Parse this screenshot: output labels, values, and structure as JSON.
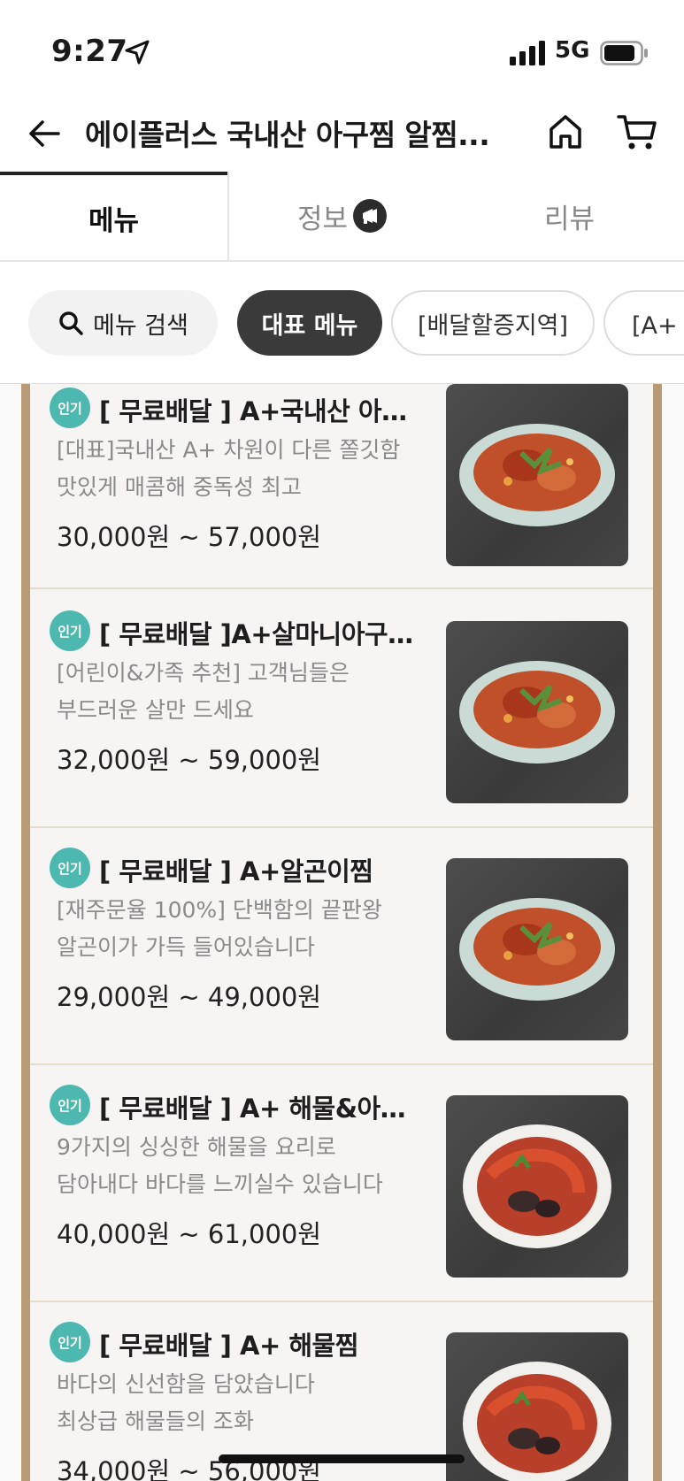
{
  "status_bar": {
    "time": "9:27",
    "network": "5G"
  },
  "header": {
    "title": "에이플러스 국내산 아구찜 알찜..."
  },
  "tabs": [
    {
      "label": "메뉴"
    },
    {
      "label": "정보"
    },
    {
      "label": "리뷰"
    }
  ],
  "chips": {
    "search": "메뉴 검색",
    "representative": "대표 메뉴",
    "surcharge": "[배달할증지역]",
    "more": "[A+ 추"
  },
  "menu_items": [
    {
      "badge": "인기",
      "name": "[ 무료배달 ] A+국내산 아…",
      "desc1": "[대표]국내산 A+ 차원이 다른 쫄깃함",
      "desc2": "맛있게 매콤해 중독성 최고",
      "price": "30,000원 ~ 57,000원"
    },
    {
      "badge": "인기",
      "name": "[ 무료배달 ]A+살마니아구…",
      "desc1": "[어린이&가족 추천] 고객님들은",
      "desc2": "부드러운 살만 드세요",
      "price": "32,000원 ~ 59,000원"
    },
    {
      "badge": "인기",
      "name": "[ 무료배달 ] A+알곤이찜",
      "desc1": "[재주문율 100%] 단백함의 끝판왕",
      "desc2": "알곤이가 가득 들어있습니다",
      "price": "29,000원 ~ 49,000원"
    },
    {
      "badge": "인기",
      "name": "[ 무료배달 ] A+ 해물&아…",
      "desc1": "9가지의 싱싱한 해물을 요리로",
      "desc2": "담아내다 바다를 느끼실수 있습니다",
      "price": "40,000원 ~ 61,000원"
    },
    {
      "badge": "인기",
      "name": "[ 무료배달 ] A+ 해물찜",
      "desc1": "바다의 신선함을 담았습니다",
      "desc2": "최상급 해물들의 조화",
      "price": "34,000원 ~ 56,000원"
    }
  ],
  "colors": {
    "badge": "#4cb8b0",
    "frame": "#b89a74",
    "active_chip": "#3a3a3a"
  }
}
